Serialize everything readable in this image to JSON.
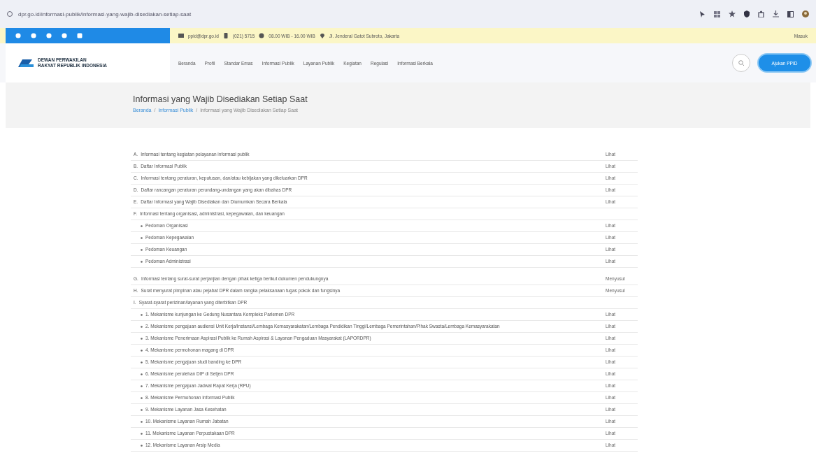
{
  "browser": {
    "url": "dpr.go.id/informasi-publik/informasi-yang-wajib-disediakan-setiap-saat"
  },
  "topbar": {
    "email": "ppid@dpr.go.id",
    "phone": "(021) 5715",
    "hours": "08.00 WIB - 16.00 WIB",
    "address": "Jl. Jenderal Gatot Subroto, Jakarta",
    "login": "Masuk"
  },
  "header": {
    "logo_line_1": "DEWAN PERWAKILAN",
    "logo_line_2": "RAKYAT REPUBLIK INDONESIA",
    "nav": [
      {
        "label": "Beranda"
      },
      {
        "label": "Profil"
      },
      {
        "label": "Standar Emas"
      },
      {
        "label": "Informasi Publik"
      },
      {
        "label": "Layanan Publik"
      },
      {
        "label": "Kegiatan"
      },
      {
        "label": "Regulasi"
      },
      {
        "label": "Informasi Berkala"
      }
    ],
    "cta": "Ajukan PPID"
  },
  "page": {
    "title": "Informasi yang Wajib Disediakan Setiap Saat",
    "breadcrumb_separator": "/",
    "breadcrumb": [
      "Beranda",
      "Informasi Publik",
      "Informasi yang Wajib Disediakan Setiap Saat"
    ]
  },
  "items": [
    {
      "marker": "A.",
      "text": "Informasi tentang kegiatan pelayanan informasi publik",
      "link": "Lihat"
    },
    {
      "marker": "B.",
      "text": "Daftar Informasi Publik",
      "link": "Lihat"
    },
    {
      "marker": "C.",
      "text": "Informasi tentang peraturan, keputusan, dan/atau kebijakan yang dikeluarkan DPR",
      "link": "Lihat"
    },
    {
      "marker": "D.",
      "text": "Daftar rancangan peraturan perundang-undangan yang akan dibahas DPR",
      "link": "Lihat"
    },
    {
      "marker": "E.",
      "text": "Daftar Informasi yang Wajib Disediakan dan Diumumkan Secara Berkala",
      "link": "Lihat"
    },
    {
      "marker": "F.",
      "text": "Informasi tentang organisasi, administrasi, kepegawaian, dan keuangan",
      "children": [
        {
          "text": "Pedoman Organisasi",
          "link": "Lihat"
        },
        {
          "text": "Pedoman Kepegawaian",
          "link": "Lihat"
        },
        {
          "text": "Pedoman Keuangan",
          "link": "Lihat"
        },
        {
          "text": "Pedoman Administrasi",
          "link": "Lihat"
        }
      ]
    },
    {
      "marker": "G.",
      "text": "Informasi tentang surat-surat perjanjian dengan pihak ketiga berikut dokumen pendukungnya",
      "link": "Menyusul"
    },
    {
      "marker": "H.",
      "text": "Surat menyurat pimpinan atau pejabat DPR dalam rangka pelaksanaan tugas pokok dan fungsinya",
      "link": "Menyusul"
    },
    {
      "marker": "I.",
      "text": "Syarat-syarat perizinan/layanan yang diterbitkan DPR",
      "children": [
        {
          "text": "1. Mekanisme kunjungan ke Gedung Nusantara Kompleks Parlemen DPR",
          "link": "Lihat"
        },
        {
          "text": "2. Mekanisme pengajuan audiensi Unit Kerja/Instansi/Lembaga Kemasyarakatan/Lembaga Pendidikan Tinggi/Lembaga Pemerintahan/Pihak Swasta/Lembaga Kemasyarakatan",
          "link": "Lihat"
        },
        {
          "text": "3. Mekanisme Penerimaan Aspirasi Publik ke Rumah Aspirasi & Layanan Pengaduan Masyarakat (LAPORDPR)",
          "link": "Lihat"
        },
        {
          "text": "4. Mekanisme permohonan magang di DPR",
          "link": "Lihat"
        },
        {
          "text": "5. Mekanisme pengajuan studi banding ke DPR",
          "link": "Lihat"
        },
        {
          "text": "6. Mekanisme perolehan DIP di Setjen DPR",
          "link": "Lihat"
        },
        {
          "text": "7. Mekanisme pengajuan Jadwal Rapat Kerja (RPU)",
          "link": "Lihat"
        },
        {
          "text": "8. Mekanisme Permohonan Informasi Publik",
          "link": "Lihat"
        },
        {
          "text": "9. Mekanisme Layanan Jasa Kesehatan",
          "link": "Lihat"
        },
        {
          "text": "10. Mekanisme Layanan Rumah Jabatan",
          "link": "Lihat"
        },
        {
          "text": "11. Mekanisme Layanan Perpustakaan DPR",
          "link": "Lihat"
        },
        {
          "text": "12. Mekanisme Layanan Arsip Media",
          "link": "Lihat"
        }
      ]
    }
  ]
}
